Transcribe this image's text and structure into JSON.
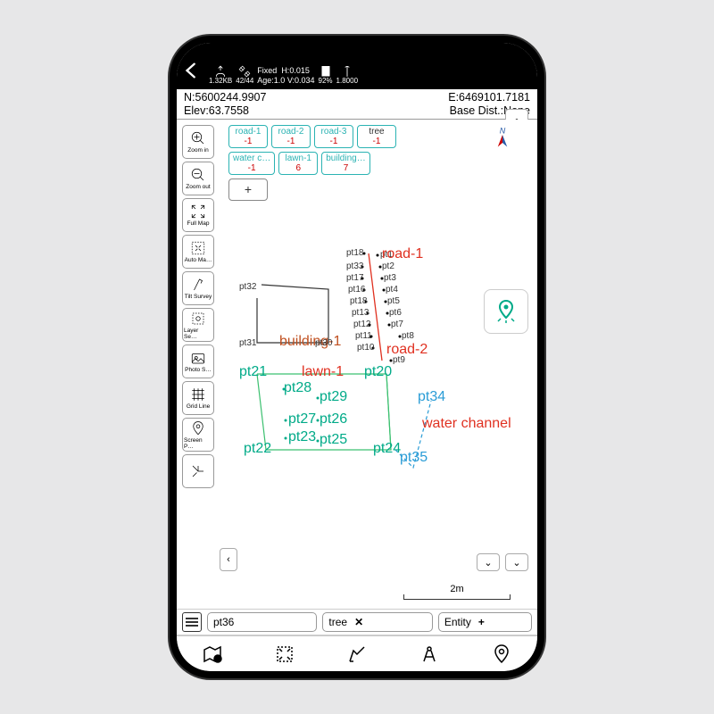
{
  "status": {
    "data_rate": "1.32KB",
    "satellites": "42/44",
    "solution": "Fixed",
    "h": "H:0.015",
    "v": "V:0.034",
    "age": "Age:1.0",
    "battery": "92%",
    "antenna": "1.8000"
  },
  "coords": {
    "n": "N:5600244.9907",
    "e": "E:6469101.7181",
    "elev": "Elev:63.7558",
    "base": "Base Dist.:None"
  },
  "layers": [
    {
      "name": "road-1",
      "cnt": "-1",
      "style": "teal"
    },
    {
      "name": "road-2",
      "cnt": "-1",
      "style": "teal"
    },
    {
      "name": "road-3",
      "cnt": "-1",
      "style": "teal"
    },
    {
      "name": "tree",
      "cnt": "-1",
      "style": "grey"
    },
    {
      "name": "water c…",
      "cnt": "-1",
      "style": "teal"
    },
    {
      "name": "lawn-1",
      "cnt": "6",
      "style": "teal"
    },
    {
      "name": "building…",
      "cnt": "7",
      "style": "teal"
    }
  ],
  "tools": [
    {
      "id": "zoom-in",
      "label": "Zoom in"
    },
    {
      "id": "zoom-out",
      "label": "Zoom out"
    },
    {
      "id": "full-map",
      "label": "Full Map"
    },
    {
      "id": "auto-map",
      "label": "Auto Ma…"
    },
    {
      "id": "tilt-survey",
      "label": "Tilt Survey"
    },
    {
      "id": "layer-sel",
      "label": "Layer Se…"
    },
    {
      "id": "photo-s",
      "label": "Photo S…"
    },
    {
      "id": "grid-line",
      "label": "Grid Line"
    },
    {
      "id": "screen-p",
      "label": "Screen P…"
    }
  ],
  "map_labels": {
    "road1": "road-1",
    "road2": "road-2",
    "lawn1": "lawn-1",
    "building1": "building-1",
    "water_channel": "water channel"
  },
  "scale": "2m",
  "bottom": {
    "point_name": "pt36",
    "code": "tree",
    "entity": "Entity"
  },
  "points": [
    "pt1",
    "pt2",
    "pt3",
    "pt4",
    "pt5",
    "pt6",
    "pt7",
    "pt8",
    "pt9",
    "pt10",
    "pt11",
    "pt12",
    "pt13",
    "pt16",
    "pt17",
    "pt18",
    "pt18",
    "pt20",
    "pt21",
    "pt22",
    "pt23",
    "pt24",
    "pt25",
    "pt26",
    "pt27",
    "pt28",
    "pt29",
    "pt30",
    "pt31",
    "pt32",
    "pt33",
    "pt34",
    "pt35"
  ]
}
